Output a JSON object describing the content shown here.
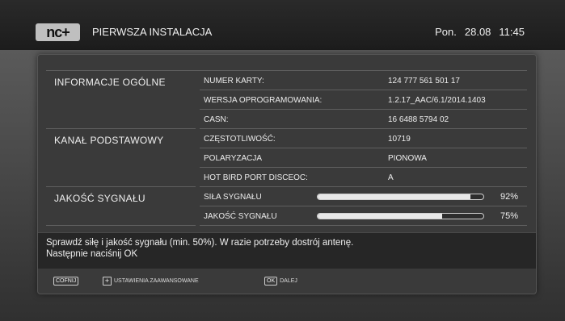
{
  "header": {
    "logo": "nc+",
    "title": "PIERWSZA INSTALACJA",
    "day": "Pon.",
    "date": "28.08",
    "time": "11:45"
  },
  "sections": {
    "general": "INFORMACJE OGÓLNE",
    "channel": "KANAŁ PODSTAWOWY",
    "signal": "JAKOŚĆ SYGNAŁU"
  },
  "rows": [
    {
      "label": "NUMER KARTY:",
      "value": "124 777 561 501 17"
    },
    {
      "label": "WERSJA OPROGRAMOWANIA:",
      "value": "1.2.17_AAC/6.1/2014.1403"
    },
    {
      "label": "CASN:",
      "value": "16 6488 5794 02"
    },
    {
      "label": "CZĘSTOTLIWOŚĆ:",
      "value": "10719"
    },
    {
      "label": "POLARYZACJA",
      "value": "PIONOWA"
    },
    {
      "label": "HOT BIRD  PORT DISCEOC:",
      "value": "A"
    }
  ],
  "meters": [
    {
      "label": "SIŁA SYGNAŁU",
      "percent": 92,
      "percent_text": "92%"
    },
    {
      "label": "JAKOŚĆ SYGNAŁU",
      "percent": 75,
      "percent_text": "75%"
    }
  ],
  "message": {
    "line1": "Sprawdź siłę i jakość sygnału (min. 50%). W razie potrzeby dostrój antenę.",
    "line2": "Następnie naciśnij OK"
  },
  "footer": {
    "back_key": "COFNIJ",
    "advanced_key": "+",
    "advanced_label": "USTAWIENIA ZAAWANSOWANE",
    "ok_key": "OK",
    "ok_label": "DALEJ"
  }
}
